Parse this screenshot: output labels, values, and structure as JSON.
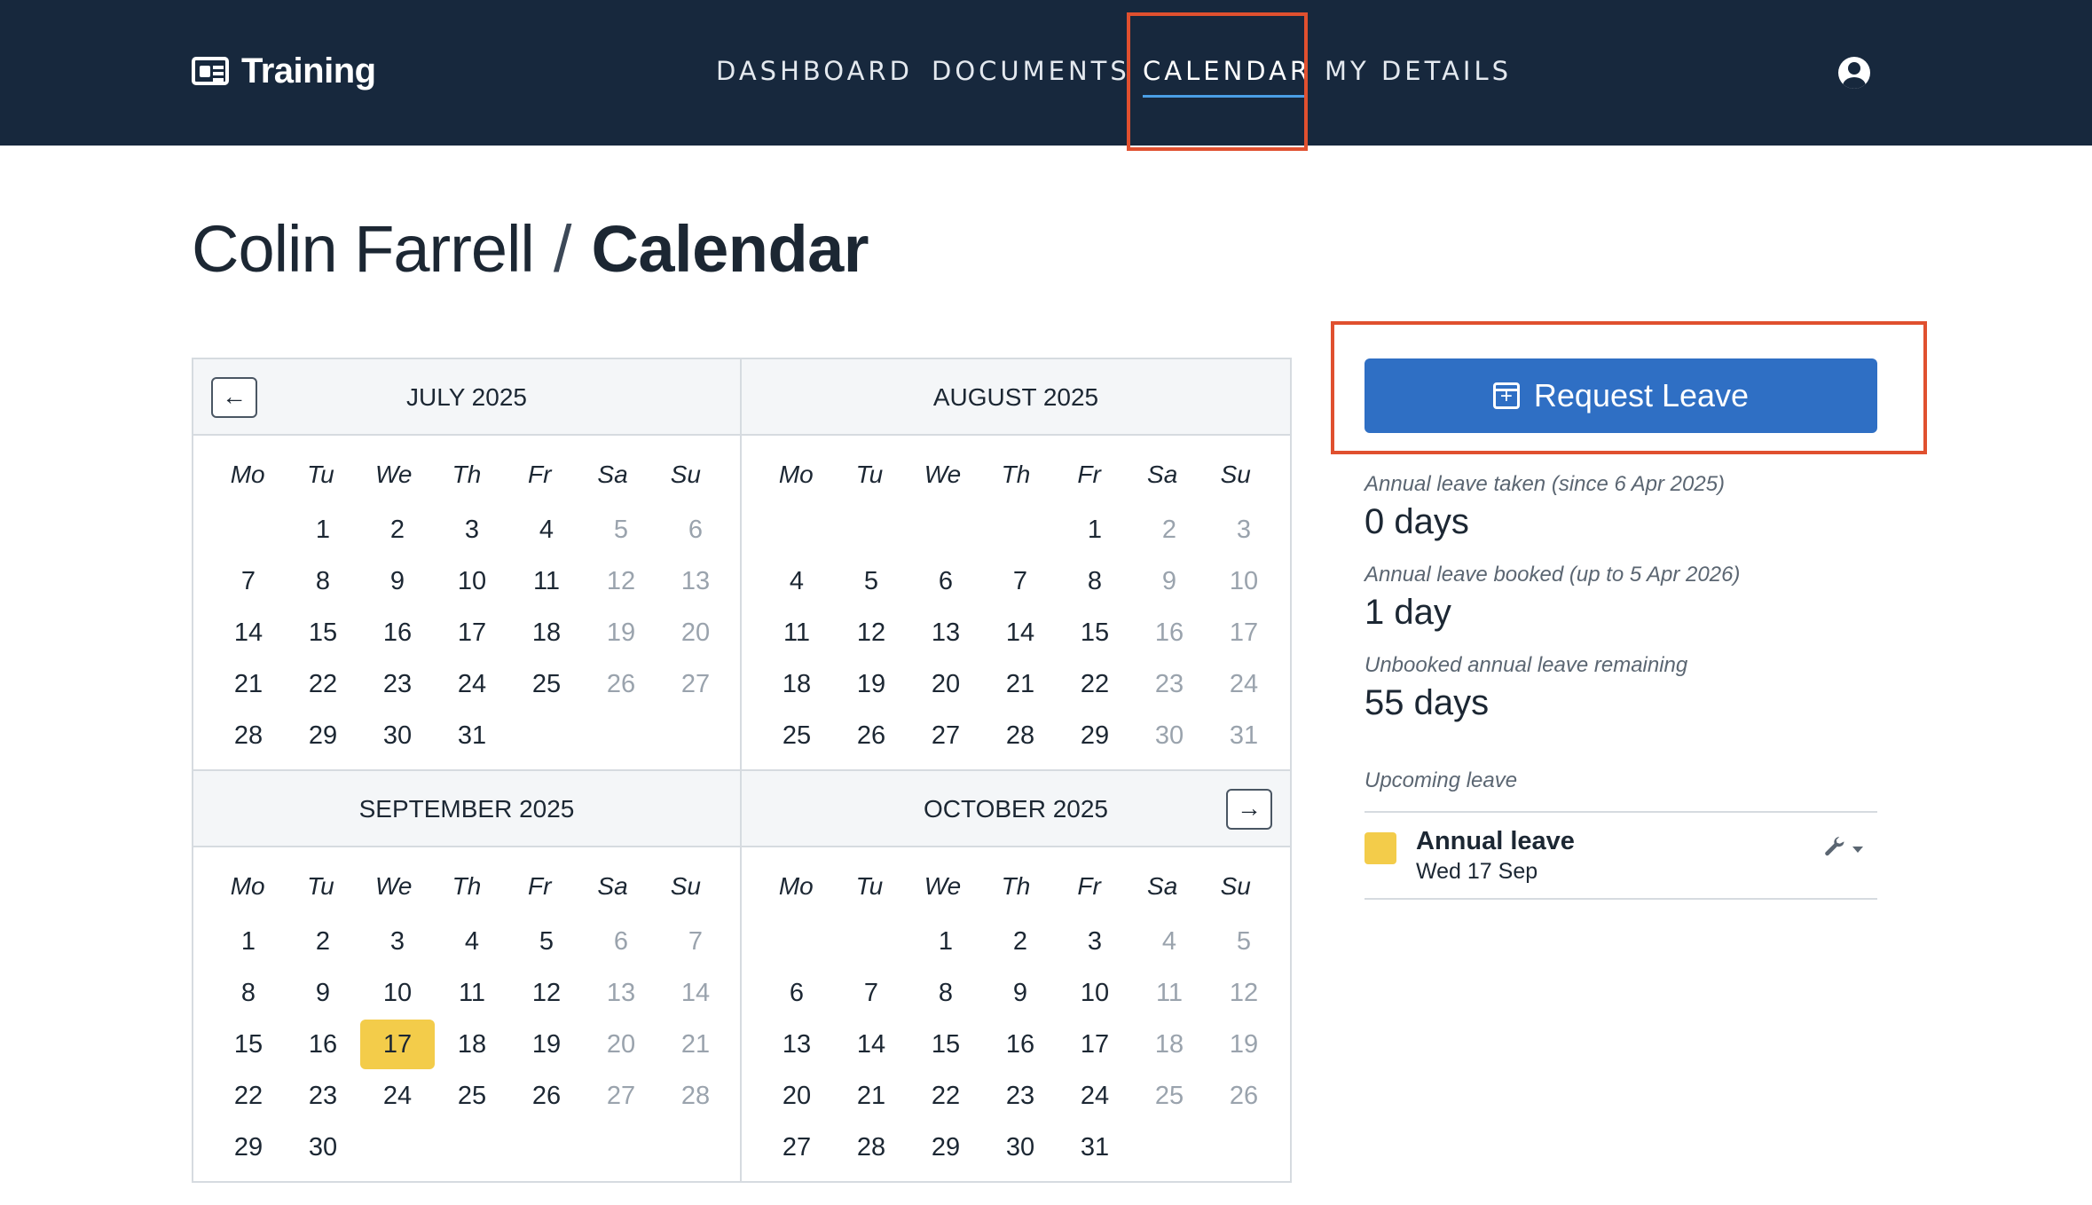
{
  "brand": {
    "name": "Training"
  },
  "nav": [
    {
      "label": "DASHBOARD",
      "active": false
    },
    {
      "label": "DOCUMENTS",
      "active": false
    },
    {
      "label": "CALENDAR",
      "active": true
    },
    {
      "label": "MY DETAILS",
      "active": false
    }
  ],
  "page": {
    "person": "Colin Farrell",
    "separator": "/",
    "section": "Calendar"
  },
  "calendar": {
    "weekdays": [
      "Mo",
      "Tu",
      "We",
      "Th",
      "Fr",
      "Sa",
      "Su"
    ],
    "prev_icon": "arrow-left-icon",
    "next_icon": "arrow-right-icon",
    "months": [
      {
        "title": "JULY 2025",
        "first_weekday": 1,
        "days": 31
      },
      {
        "title": "AUGUST 2025",
        "first_weekday": 4,
        "days": 31
      },
      {
        "title": "SEPTEMBER 2025",
        "first_weekday": 0,
        "days": 30,
        "highlighted": [
          17
        ]
      },
      {
        "title": "OCTOBER 2025",
        "first_weekday": 2,
        "days": 31
      }
    ],
    "highlight_color": "#f3cc4a"
  },
  "panel": {
    "request_button": "Request Leave",
    "stats": [
      {
        "label": "Annual leave taken (since 6 Apr 2025)",
        "value": "0 days"
      },
      {
        "label": "Annual leave booked (up to 5 Apr 2026)",
        "value": "1 day"
      },
      {
        "label": "Unbooked annual leave remaining",
        "value": "55 days"
      }
    ],
    "upcoming_label": "Upcoming leave",
    "upcoming": [
      {
        "title": "Annual leave",
        "date": "Wed 17 Sep",
        "color": "#f3cc4a"
      }
    ]
  },
  "colors": {
    "topbar": "#17283d",
    "accent": "#2f6fc4",
    "callout": "#e0502f"
  }
}
